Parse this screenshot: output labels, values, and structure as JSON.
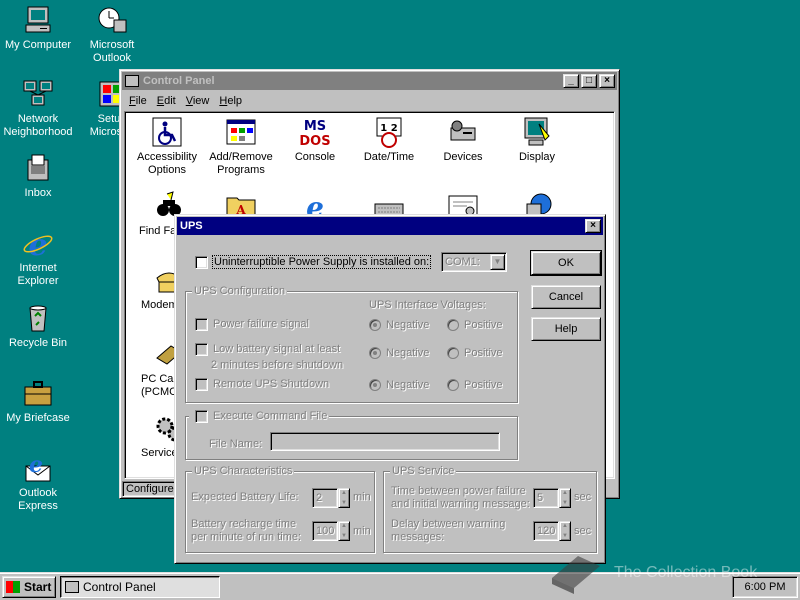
{
  "desktop": {
    "icons": [
      {
        "label": "My Computer",
        "icon": "my-computer-icon"
      },
      {
        "label": "Microsoft Outlook",
        "icon": "outlook-icon"
      },
      {
        "label": "Network Neighborhood",
        "icon": "network-icon"
      },
      {
        "label": "Setup Microsoft",
        "icon": "setup-icon"
      },
      {
        "label": "Inbox",
        "icon": "inbox-icon"
      },
      {
        "label": "Internet Explorer",
        "icon": "ie-icon"
      },
      {
        "label": "Recycle Bin",
        "icon": "recycle-bin-icon"
      },
      {
        "label": "My Briefcase",
        "icon": "briefcase-icon"
      },
      {
        "label": "Outlook Express",
        "icon": "outlook-express-icon"
      }
    ]
  },
  "control_panel": {
    "title": "Control Panel",
    "menu": [
      "File",
      "Edit",
      "View",
      "Help"
    ],
    "items": [
      {
        "label": "Accessibility Options",
        "icon": "accessibility-icon"
      },
      {
        "label": "Add/Remove Programs",
        "icon": "add-remove-icon"
      },
      {
        "label": "Console",
        "icon": "console-icon"
      },
      {
        "label": "Date/Time",
        "icon": "date-time-icon"
      },
      {
        "label": "Devices",
        "icon": "devices-icon"
      },
      {
        "label": "Display",
        "icon": "display-icon"
      },
      {
        "label": "Find Fa",
        "icon": "find-fast-icon"
      },
      {
        "label": "Modem",
        "icon": "modem-icon"
      },
      {
        "label": "PC Car (PCMCI",
        "icon": "pc-card-icon"
      },
      {
        "label": "Service",
        "icon": "services-icon"
      }
    ],
    "status": "Configures"
  },
  "ups_dialog": {
    "title": "UPS",
    "installed_label": "Uninterruptible Power Supply is installed on:",
    "port_value": "COM1:",
    "ok": "OK",
    "cancel": "Cancel",
    "help": "Help",
    "config_group": "UPS Configuration",
    "voltages_label": "UPS Interface Voltages:",
    "power_failure": "Power failure signal",
    "low_battery_1": "Low battery signal at least",
    "low_battery_2": "2 minutes before shutdown",
    "remote_shutdown": "Remote UPS Shutdown",
    "negative": "Negative",
    "positive": "Positive",
    "execute_command": "Execute Command File",
    "file_name_label": "File Name:",
    "characteristics_group": "UPS Characteristics",
    "expected_life_label": "Expected  Battery Life:",
    "expected_life_value": "2",
    "min": "min",
    "recharge_label_1": "Battery recharge time",
    "recharge_label_2": "per minute of run time:",
    "recharge_value": "100",
    "service_group": "UPS Service",
    "time_between_1": "Time between power failure",
    "time_between_2": "and initial warning message:",
    "time_between_value": "5",
    "sec": "sec",
    "delay_1": "Delay between warning",
    "delay_2": "messages:",
    "delay_value": "120"
  },
  "taskbar": {
    "start": "Start",
    "task": "Control Panel",
    "clock": "6:00 PM"
  },
  "watermark": "The Collection Book"
}
